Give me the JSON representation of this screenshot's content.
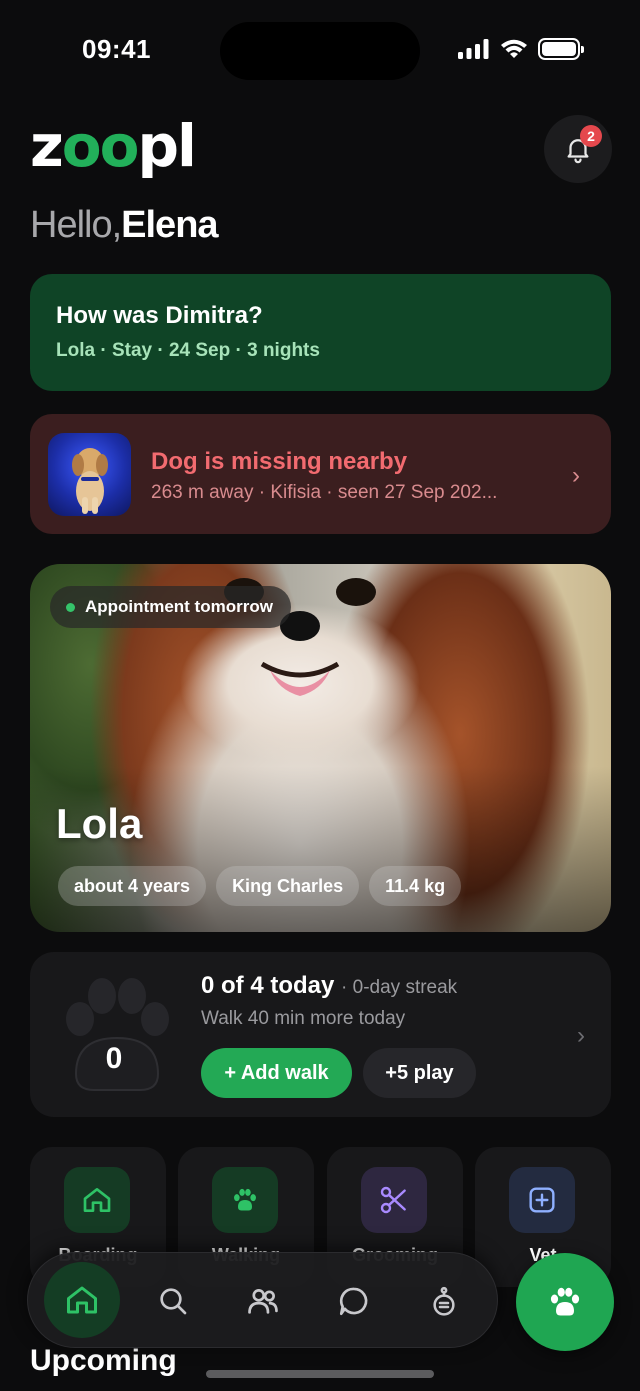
{
  "status_bar": {
    "time": "09:41"
  },
  "header": {
    "logo_text_start": "z",
    "logo_text_oo": "oo",
    "logo_text_end": "pl",
    "notification_count": "2"
  },
  "greeting": {
    "hello": "Hello,",
    "name": "Elena"
  },
  "review_card": {
    "title": "How was Dimitra?",
    "subtitle": "Lola · Stay · 24 Sep · 3 nights"
  },
  "missing_card": {
    "title": "Dog is missing nearby",
    "subtitle": "263 m away · Kifisia · seen 27 Sep 202..."
  },
  "pet": {
    "status": "Appointment tomorrow",
    "name": "Lola",
    "chips": [
      "about 4 years",
      "King Charles",
      "11.4 kg"
    ]
  },
  "activity": {
    "count": "0",
    "title": "0 of 4 today",
    "streak": "· 0-day streak",
    "subtitle": "Walk 40 min more today",
    "add_walk": "+ Add walk",
    "play": "+5 play"
  },
  "services": [
    {
      "icon": "house-icon",
      "label": "Boarding",
      "color": "#1f7a45",
      "bg": "#153b24"
    },
    {
      "icon": "paw-icon",
      "label": "Walking",
      "color": "#2ec266",
      "bg": "#153b24"
    },
    {
      "icon": "scissors-icon",
      "label": "Grooming",
      "color": "#a98aff",
      "bg": "#2e2740"
    },
    {
      "icon": "plus-square-icon",
      "label": "Vet",
      "color": "#8fb0ff",
      "bg": "#232b40"
    }
  ],
  "nav": {
    "tabs": [
      "home",
      "search",
      "community",
      "messages",
      "profile"
    ],
    "active": "home"
  },
  "sections": {
    "upcoming": "Upcoming"
  },
  "colors": {
    "accent": "#23a955",
    "missing": "#f26b70",
    "background": "#0c0c0d"
  }
}
